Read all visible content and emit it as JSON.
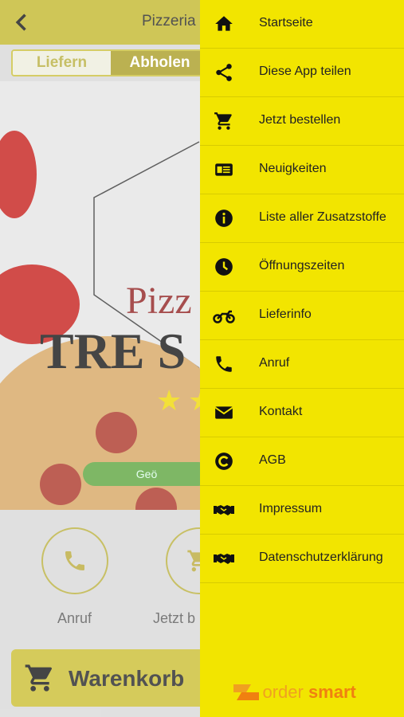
{
  "header": {
    "title": "Pizzeria"
  },
  "order_mode": {
    "options": [
      "Liefern",
      "Abholen"
    ]
  },
  "hero": {
    "logo_top": "Pizz",
    "logo_main": "TRE S",
    "button_text": "Geö"
  },
  "actions": [
    {
      "label": "Anruf",
      "icon": "phone-icon"
    },
    {
      "label": "Jetzt b",
      "icon": "cart-icon"
    }
  ],
  "cart": {
    "label": "Warenkorb"
  },
  "drawer": {
    "items": [
      {
        "label": "Startseite",
        "icon": "home-icon"
      },
      {
        "label": "Diese App teilen",
        "icon": "share-icon"
      },
      {
        "label": "Jetzt bestellen",
        "icon": "cart-icon"
      },
      {
        "label": "Neuigkeiten",
        "icon": "news-icon"
      },
      {
        "label": "Liste aller Zusatzstoffe",
        "icon": "info-icon"
      },
      {
        "label": "Öffnungszeiten",
        "icon": "clock-icon"
      },
      {
        "label": "Lieferinfo",
        "icon": "motorcycle-icon"
      },
      {
        "label": "Anruf",
        "icon": "phone-icon"
      },
      {
        "label": "Kontakt",
        "icon": "envelope-icon"
      },
      {
        "label": "AGB",
        "icon": "copyright-icon"
      },
      {
        "label": "Impressum",
        "icon": "handshake-icon"
      },
      {
        "label": "Datenschutzerklärung",
        "icon": "handshake-icon"
      }
    ],
    "brand": {
      "part1": "order ",
      "part2": "smart"
    }
  },
  "colors": {
    "drawer_bg": "#f2e500",
    "header_bg": "#c2b628",
    "accent": "#a89c20"
  }
}
